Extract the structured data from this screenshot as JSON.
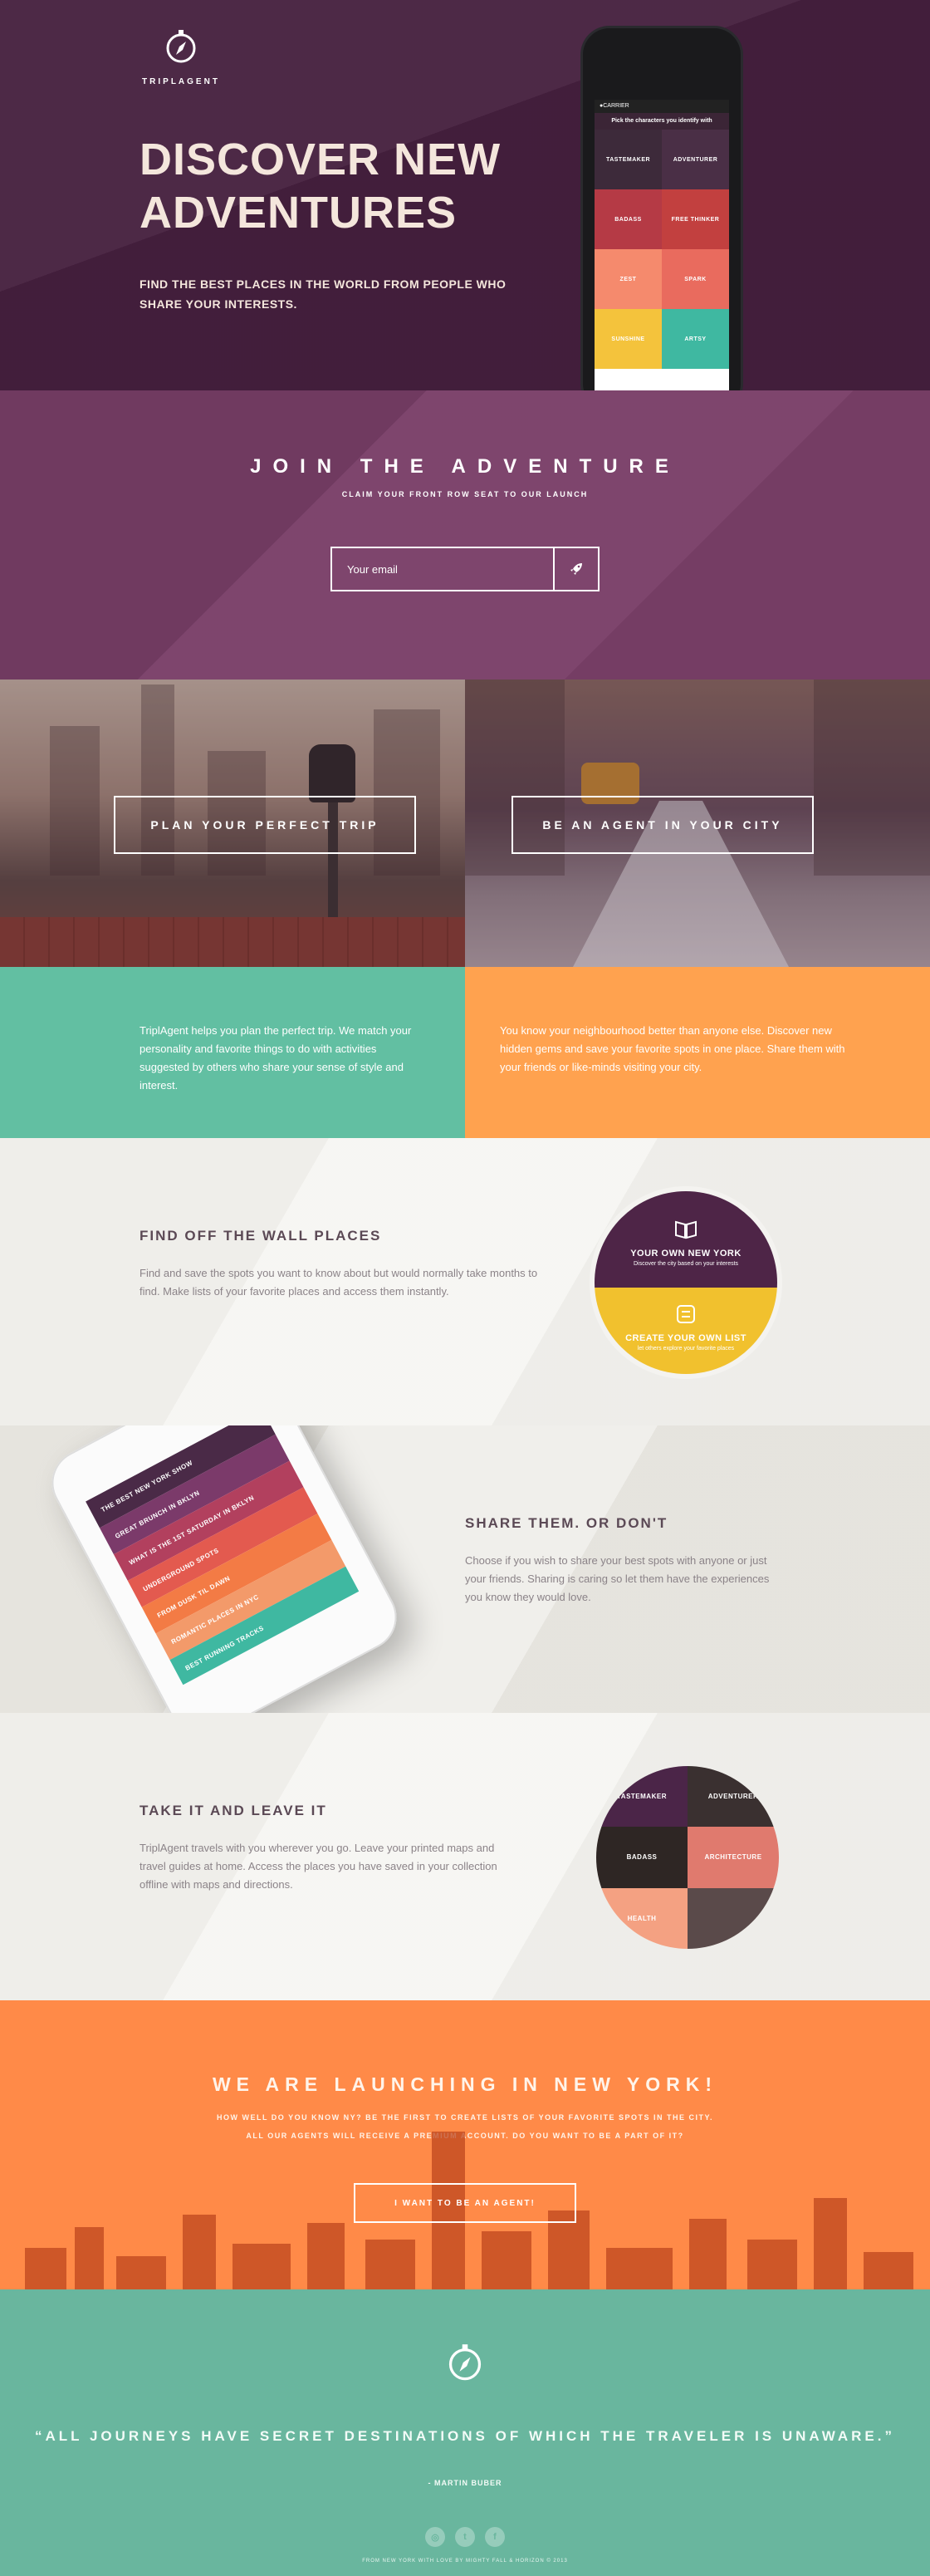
{
  "brand": {
    "name": "TRIPLAGENT"
  },
  "hero": {
    "title": "DISCOVER NEW ADVENTURES",
    "subtitle": "FIND THE BEST PLACES IN THE WORLD FROM PEOPLE WHO SHARE YOUR INTERESTS.",
    "phone": {
      "carrier": "●CARRIER",
      "prompt": "Pick the characters you identify with",
      "tiles": [
        {
          "label": "TASTEMAKER",
          "color": "#3d2a3a"
        },
        {
          "label": "ADVENTURER",
          "color": "#4a2f46"
        },
        {
          "label": "BADASS",
          "color": "#b53a45"
        },
        {
          "label": "FREE THINKER",
          "color": "#c2403f"
        },
        {
          "label": "ZEST",
          "color": "#f58a6d"
        },
        {
          "label": "SPARK",
          "color": "#e96b5e"
        },
        {
          "label": "SUNSHINE",
          "color": "#f4c33c"
        },
        {
          "label": "ARTSY",
          "color": "#3fb8a1"
        }
      ]
    }
  },
  "join": {
    "title": "JOIN THE ADVENTURE",
    "claim": "CLAIM YOUR FRONT ROW SEAT TO OUR LAUNCH",
    "email_placeholder": "Your email"
  },
  "photos": {
    "left_button": "PLAN YOUR PERFECT TRIP",
    "right_button": "BE AN AGENT IN YOUR CITY"
  },
  "info": {
    "left": "TriplAgent helps you plan the perfect trip. We match your personality and favorite things to do with activities suggested by others who share your sense of style and interest.",
    "right": "You know your neighbourhood better than anyone else. Discover new hidden gems and save your favorite spots in one place. Share them with your friends or like-minds visiting your city."
  },
  "features": {
    "f1": {
      "title": "FIND OFF THE WALL PLACES",
      "text": "Find and save the spots you want to know about but would normally take months to find. Make lists of your favorite places and access them instantly.",
      "badge_top_title": "YOUR OWN NEW YORK",
      "badge_top_sub": "Discover the city based on your interests",
      "badge_bottom_title": "CREATE YOUR OWN LIST",
      "badge_bottom_sub": "let others explore your favorite places"
    },
    "f2": {
      "title": "SHARE THEM. OR DON'T",
      "text": "Choose if you wish to share your best spots with anyone or just your friends. Sharing is caring so let them have the experiences you know they would love.",
      "phone_rows": [
        {
          "label": "THE BEST NEW YORK SHOW",
          "color": "#4a2a47"
        },
        {
          "label": "GREAT BRUNCH IN BKLYN",
          "color": "#7b3a6a"
        },
        {
          "label": "WHAT IS THE 1ST SATURDAY IN BKLYN",
          "color": "#b2405e"
        },
        {
          "label": "UNDERGROUND SPOTS",
          "color": "#e35a4f"
        },
        {
          "label": "FROM DUSK TIL DAWN",
          "color": "#f37b45"
        },
        {
          "label": "ROMANTIC PLACES IN NYC",
          "color": "#f39a6a"
        },
        {
          "label": "BEST RUNNING TRACKS",
          "color": "#3fb8a1"
        }
      ]
    },
    "f3": {
      "title": "TAKE IT AND LEAVE IT",
      "text": "TriplAgent travels with you wherever you go. Leave your printed maps and travel guides at home. Access the places you have saved in your collection offline with maps and directions.",
      "tiles": [
        {
          "label": "TASTEMAKER",
          "color": "#4b2548"
        },
        {
          "label": "ADVENTURER",
          "color": "#3a3030"
        },
        {
          "label": "BADASS",
          "color": "#2e2624"
        },
        {
          "label": "ARCHITECTURE",
          "color": "#e07a6e"
        },
        {
          "label": "HEALTH",
          "color": "#f4a182"
        },
        {
          "label": "",
          "color": "#5a4a4a"
        }
      ]
    }
  },
  "launch": {
    "title": "WE ARE LAUNCHING IN NEW YORK!",
    "line1": "HOW WELL DO YOU KNOW NY? BE THE FIRST TO CREATE LISTS OF YOUR FAVORITE SPOTS IN THE CITY.",
    "line2": "ALL OUR AGENTS WILL RECEIVE A PREMIUM ACCOUNT. DO YOU WANT TO BE A PART OF IT?",
    "cta": "I WANT TO BE AN AGENT!"
  },
  "footer": {
    "quote": "“ALL JOURNEYS HAVE SECRET DESTINATIONS OF WHICH THE TRAVELER IS UNAWARE.”",
    "author": "- MARTIN BUBER",
    "social": [
      "instagram-icon",
      "twitter-icon",
      "facebook-icon"
    ],
    "credit": "FROM NEW YORK WITH LOVE BY MIGHTY FALL & HORIZON © 2013"
  },
  "colors": {
    "hero_bg": "#46203f",
    "join_bg": "#7a3f68",
    "teal": "#62bfa2",
    "orange": "#ffa24f",
    "launch_bg": "#ff8a48",
    "footer_bg": "#69b69e"
  }
}
